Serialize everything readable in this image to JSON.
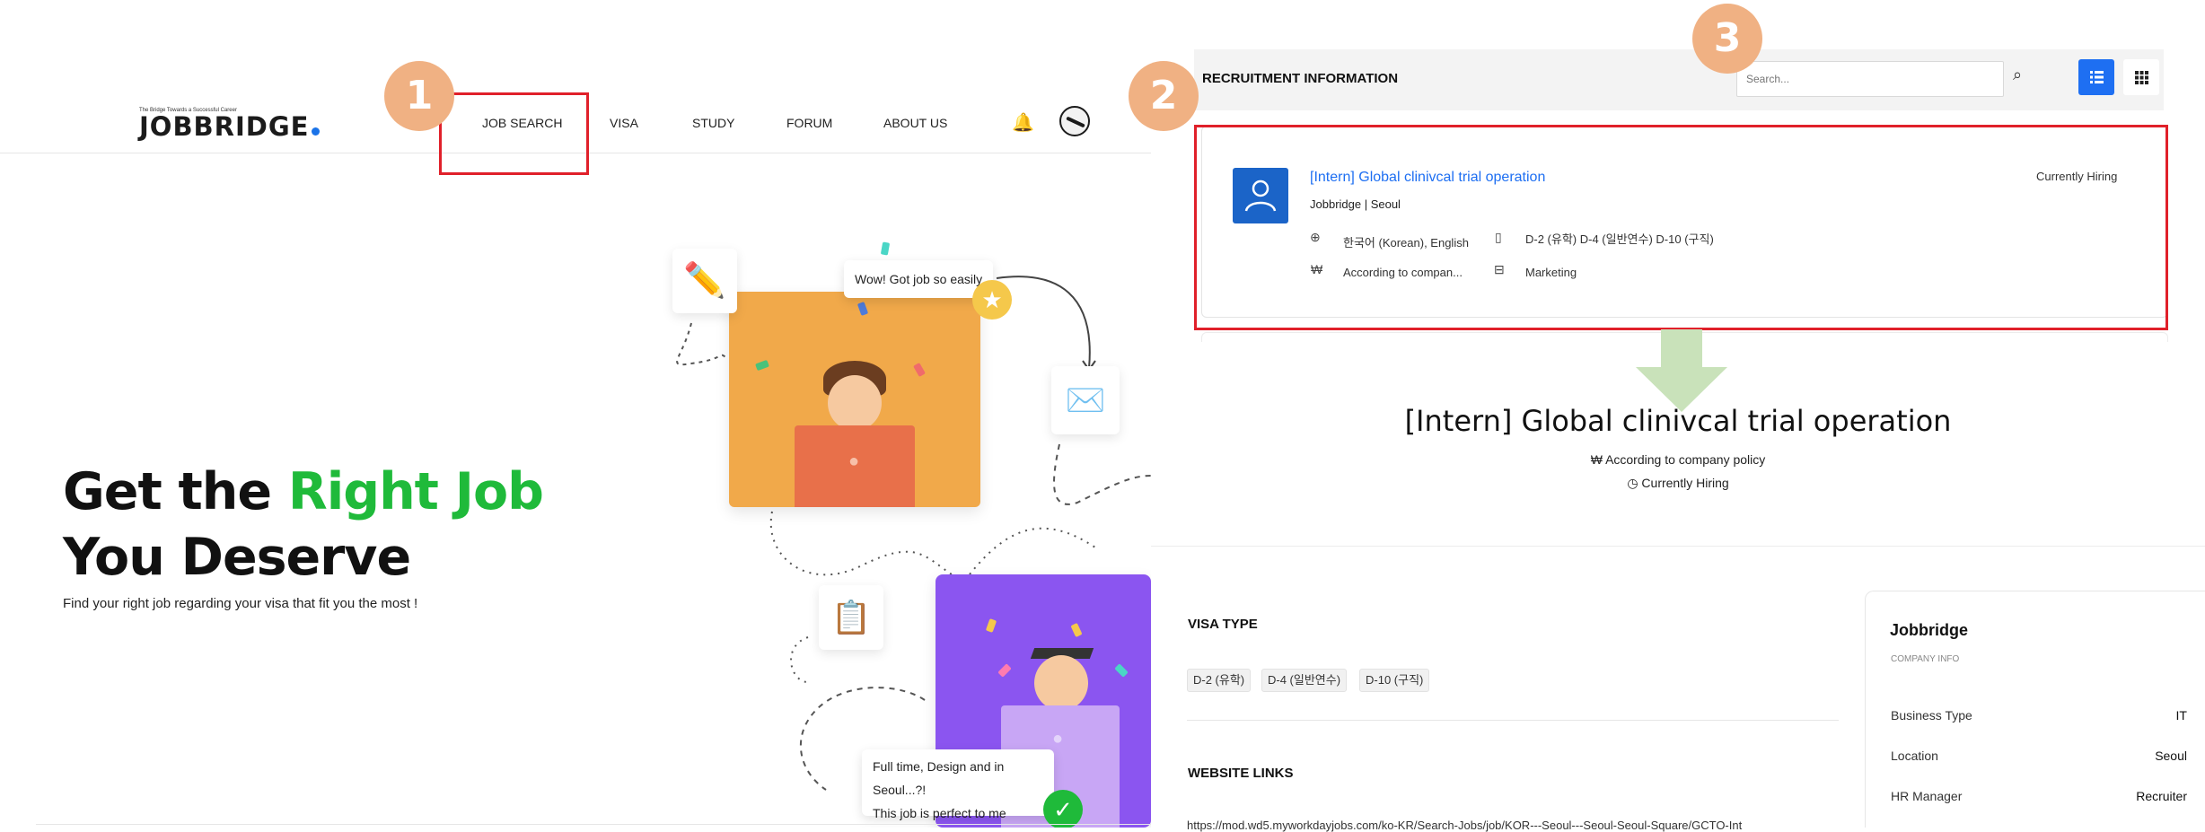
{
  "badges": [
    "1",
    "2",
    "3"
  ],
  "site": {
    "logo_tagline": "The Bridge Towards a Successful Career",
    "logo_text": "JOBBRIDGE"
  },
  "nav": {
    "items": [
      "JOB SEARCH",
      "VISA",
      "STUDY",
      "FORUM",
      "ABOUT US"
    ]
  },
  "hero": {
    "line1_prefix": "Get the ",
    "line1_highlight": "Right Job",
    "line2": "You Deserve",
    "subtitle": "Find your right job regarding your visa that fit you the most !"
  },
  "illustration": {
    "bubble_top": "Wow! Got job so easily",
    "bubble_bottom_line1": "Full time, Design and in Seoul...?!",
    "bubble_bottom_line2": "This job is perfect to me"
  },
  "listing": {
    "section_title": "RECRUITMENT INFORMATION",
    "search_placeholder": "Search...",
    "job": {
      "title": "[Intern] Global clinivcal trial operation",
      "company_location": "Jobbridge | Seoul",
      "languages": "한국어 (Korean), English",
      "visas": "D-2 (유학) D-4 (일반연수) D-10 (구직)",
      "salary": "According to compan...",
      "category": "Marketing",
      "status": "Currently Hiring"
    }
  },
  "detail": {
    "title": "[Intern] Global clinivcal trial operation",
    "salary_line": "According to company policy",
    "status_line": "Currently Hiring",
    "visa_type_heading": "VISA TYPE",
    "visa_chips": [
      "D-2 (유학)",
      "D-4 (일반연수)",
      "D-10 (구직)"
    ],
    "website_heading": "WEBSITE LINKS",
    "website_link": "https://mod.wd5.myworkdayjobs.com/ko-KR/Search-Jobs/job/KOR---Seoul---Seoul-Seoul-Square/GCTO-Int",
    "company_card": {
      "name": "Jobbridge",
      "subtitle": "COMPANY INFO",
      "rows": [
        {
          "label": "Business Type",
          "value": "IT"
        },
        {
          "label": "Location",
          "value": "Seoul"
        },
        {
          "label": "HR Manager",
          "value": "Recruiter"
        }
      ]
    }
  },
  "colors": {
    "accent_blue": "#1e6ff2",
    "hero_green": "#1fba3a",
    "highlight_red": "#e0202a",
    "badge_peach": "#f0b183",
    "arrow_green": "#c9e2ba"
  }
}
